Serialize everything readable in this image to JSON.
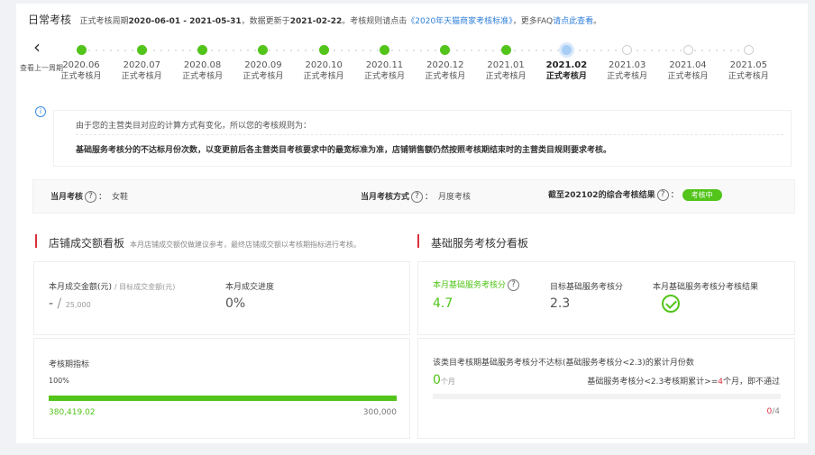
{
  "header": {
    "title": "日常考核",
    "cycle_prefix": "正式考核周期",
    "cycle_range": "2020-06-01 - 2021-05-31",
    "update_prefix": "，数据更新于",
    "update_date": "2021-02-22",
    "rule_prefix": "。考核规则请点击",
    "rule_link": "《2020年天猫商家考核标准》",
    "faq_prefix": "，更多FAQ",
    "faq_link": "请点此查看",
    "faq_suffix": "。"
  },
  "prev_period": {
    "label": "查看上一周期"
  },
  "timeline": [
    {
      "month": "2020.06",
      "sub": "正式考核月",
      "state": "done"
    },
    {
      "month": "2020.07",
      "sub": "正式考核月",
      "state": "done"
    },
    {
      "month": "2020.08",
      "sub": "正式考核月",
      "state": "done"
    },
    {
      "month": "2020.09",
      "sub": "正式考核月",
      "state": "done"
    },
    {
      "month": "2020.10",
      "sub": "正式考核月",
      "state": "done"
    },
    {
      "month": "2020.11",
      "sub": "正式考核月",
      "state": "done"
    },
    {
      "month": "2020.12",
      "sub": "正式考核月",
      "state": "done"
    },
    {
      "month": "2021.01",
      "sub": "正式考核月",
      "state": "done"
    },
    {
      "month": "2021.02",
      "sub": "正式考核月",
      "state": "current"
    },
    {
      "month": "2021.03",
      "sub": "正式考核月",
      "state": "future"
    },
    {
      "month": "2021.04",
      "sub": "正式考核月",
      "state": "future"
    },
    {
      "month": "2021.05",
      "sub": "正式考核月",
      "state": "future"
    }
  ],
  "notice": {
    "icon": "info-icon",
    "line1": "由于您的主营类目对应的计算方式有变化，所以您的考核规则为：",
    "line2": "基础服务考核分的不达标月份次数，以变更前后各主营类目考核要求中的最宽标准为准，店铺销售额仍然按照考核期结束时的主营类目规则要求考核。"
  },
  "summary": {
    "month_label": "当月考核",
    "month_value": "女鞋",
    "method_label": "当月考核方式",
    "method_value": "月度考核",
    "result_label": "截至202102的综合考核结果",
    "result_badge": "考核中",
    "q": "?",
    "colon": "："
  },
  "store_board": {
    "title": "店铺成交额看板",
    "subtitle": "本月店铺成交额仅做建议参考，最终店铺成交额以考核期指标进行考核。",
    "amount_label": "本月成交金额(元)",
    "target_label": "/ 目标成交金额(元)",
    "amount_value": "-",
    "target_value": "25,000",
    "progress_label": "本月成交进度",
    "progress_value": "0%",
    "period_label": "考核期指标",
    "period_percent": "100%",
    "period_progress": 1.0,
    "period_current": "380,419.02",
    "period_target": "300,000"
  },
  "service_board": {
    "title": "基础服务考核分看板",
    "score_label": "本月基础服务考核分",
    "score_value": "4.7",
    "target_label": "目标基础服务考核分",
    "target_value": "2.3",
    "result_label": "本月基础服务考核分考核结果",
    "fail_desc": "该类目考核期基础服务考核分不达标(基础服务考核分<2.3)的累计月份数",
    "fail_count": "0",
    "fail_unit": "个月",
    "rule_prefix": "基础服务考核分<2.3考核期累计>=",
    "rule_num": "4",
    "rule_suffix": "个月，即不通过",
    "count_num": "0",
    "count_total": "/4"
  },
  "colors": {
    "accent": "#52c41a",
    "link": "#2f7fd8",
    "marker": "#d9303e"
  }
}
